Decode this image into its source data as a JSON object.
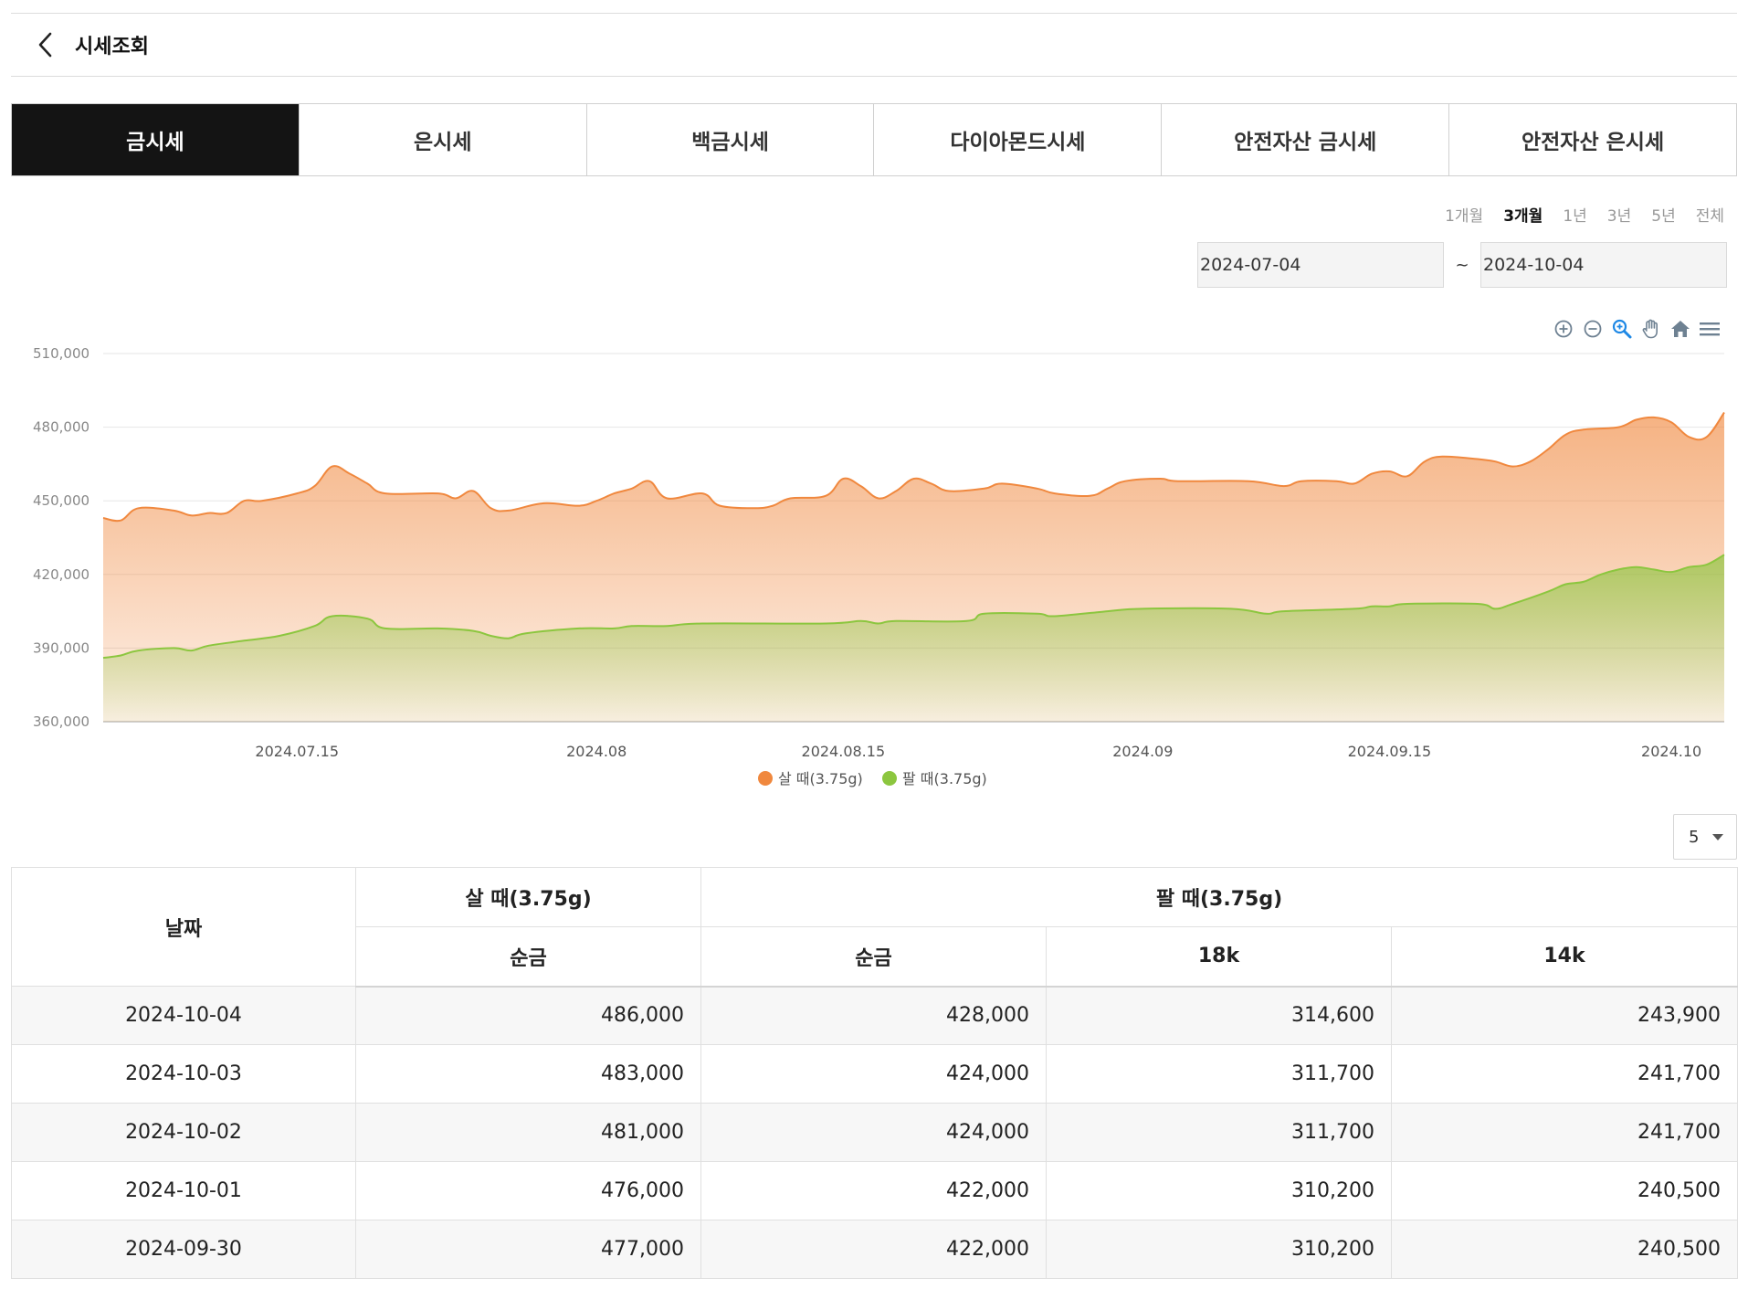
{
  "header": {
    "title": "시세조회",
    "back_icon": "chevron-left-icon"
  },
  "tabs": [
    {
      "label": "금시세",
      "active": true
    },
    {
      "label": "은시세",
      "active": false
    },
    {
      "label": "백금시세",
      "active": false
    },
    {
      "label": "다이아몬드시세",
      "active": false
    },
    {
      "label": "안전자산 금시세",
      "active": false
    },
    {
      "label": "안전자산 은시세",
      "active": false
    }
  ],
  "periods": [
    {
      "label": "1개월",
      "active": false
    },
    {
      "label": "3개월",
      "active": true
    },
    {
      "label": "1년",
      "active": false
    },
    {
      "label": "3년",
      "active": false
    },
    {
      "label": "5년",
      "active": false
    },
    {
      "label": "전체",
      "active": false
    }
  ],
  "date_range": {
    "start": "2024-07-04",
    "separator": "~",
    "end": "2024-10-04"
  },
  "toolbar_icons": [
    "zoom-in-icon",
    "zoom-out-icon",
    "selection-zoom-icon",
    "pan-hand-icon",
    "reset-home-icon",
    "menu-icon"
  ],
  "colors": {
    "buy": "#f0883e",
    "sell": "#8cc63f",
    "active_tab": "#141414"
  },
  "chart_data": {
    "type": "area",
    "ylim": [
      360000,
      510000
    ],
    "y_ticks": [
      360000,
      390000,
      420000,
      450000,
      480000,
      510000
    ],
    "y_tick_labels": [
      "360,000",
      "390,000",
      "420,000",
      "450,000",
      "480,000",
      "510,000"
    ],
    "x_range": [
      "2024-07-04",
      "2024-10-04"
    ],
    "x_ticks": [
      {
        "date": "2024-07-15",
        "label": "2024.07.15"
      },
      {
        "date": "2024-08-01",
        "label": "2024.08"
      },
      {
        "date": "2024-08-15",
        "label": "2024.08.15"
      },
      {
        "date": "2024-09-01",
        "label": "2024.09"
      },
      {
        "date": "2024-09-15",
        "label": "2024.09.15"
      },
      {
        "date": "2024-10-01",
        "label": "2024.10"
      }
    ],
    "legend_position": "bottom-center",
    "grid": true,
    "series": [
      {
        "name": "살 때(3.75g)",
        "color": "#f0883e",
        "points": [
          [
            "2024-07-04",
            443000
          ],
          [
            "2024-07-05",
            442000
          ],
          [
            "2024-07-06",
            447000
          ],
          [
            "2024-07-08",
            446000
          ],
          [
            "2024-07-09",
            444000
          ],
          [
            "2024-07-10",
            445000
          ],
          [
            "2024-07-11",
            445000
          ],
          [
            "2024-07-12",
            450000
          ],
          [
            "2024-07-13",
            450000
          ],
          [
            "2024-07-15",
            453000
          ],
          [
            "2024-07-16",
            456000
          ],
          [
            "2024-07-17",
            464000
          ],
          [
            "2024-07-18",
            461000
          ],
          [
            "2024-07-19",
            457000
          ],
          [
            "2024-07-20",
            453000
          ],
          [
            "2024-07-23",
            453000
          ],
          [
            "2024-07-24",
            451000
          ],
          [
            "2024-07-25",
            454000
          ],
          [
            "2024-07-26",
            447000
          ],
          [
            "2024-07-27",
            446000
          ],
          [
            "2024-07-29",
            449000
          ],
          [
            "2024-07-31",
            448000
          ],
          [
            "2024-08-01",
            450000
          ],
          [
            "2024-08-02",
            453000
          ],
          [
            "2024-08-03",
            455000
          ],
          [
            "2024-08-04",
            458000
          ],
          [
            "2024-08-05",
            451000
          ],
          [
            "2024-08-07",
            453000
          ],
          [
            "2024-08-08",
            448000
          ],
          [
            "2024-08-10",
            447000
          ],
          [
            "2024-08-11",
            448000
          ],
          [
            "2024-08-12",
            451000
          ],
          [
            "2024-08-14",
            452000
          ],
          [
            "2024-08-15",
            459000
          ],
          [
            "2024-08-16",
            456000
          ],
          [
            "2024-08-17",
            451000
          ],
          [
            "2024-08-18",
            454000
          ],
          [
            "2024-08-19",
            459000
          ],
          [
            "2024-08-20",
            457000
          ],
          [
            "2024-08-21",
            454000
          ],
          [
            "2024-08-23",
            455000
          ],
          [
            "2024-08-24",
            457000
          ],
          [
            "2024-08-26",
            455000
          ],
          [
            "2024-08-27",
            453000
          ],
          [
            "2024-08-29",
            452000
          ],
          [
            "2024-08-30",
            455000
          ],
          [
            "2024-08-31",
            458000
          ],
          [
            "2024-09-02",
            459000
          ],
          [
            "2024-09-03",
            458000
          ],
          [
            "2024-09-07",
            458000
          ],
          [
            "2024-09-09",
            456000
          ],
          [
            "2024-09-10",
            458000
          ],
          [
            "2024-09-12",
            458000
          ],
          [
            "2024-09-13",
            457000
          ],
          [
            "2024-09-14",
            461000
          ],
          [
            "2024-09-15",
            462000
          ],
          [
            "2024-09-16",
            460000
          ],
          [
            "2024-09-17",
            466000
          ],
          [
            "2024-09-18",
            468000
          ],
          [
            "2024-09-20",
            467000
          ],
          [
            "2024-09-21",
            466000
          ],
          [
            "2024-09-22",
            464000
          ],
          [
            "2024-09-23",
            466000
          ],
          [
            "2024-09-24",
            471000
          ],
          [
            "2024-09-25",
            477000
          ],
          [
            "2024-09-26",
            479000
          ],
          [
            "2024-09-28",
            480000
          ],
          [
            "2024-09-29",
            483000
          ],
          [
            "2024-09-30",
            484000
          ],
          [
            "2024-10-01",
            482000
          ],
          [
            "2024-10-02",
            476000
          ],
          [
            "2024-10-03",
            476000
          ],
          [
            "2024-10-04",
            486000
          ]
        ]
      },
      {
        "name": "팔 때(3.75g)",
        "color": "#8cc63f",
        "points": [
          [
            "2024-07-04",
            386000
          ],
          [
            "2024-07-05",
            387000
          ],
          [
            "2024-07-06",
            389000
          ],
          [
            "2024-07-08",
            390000
          ],
          [
            "2024-07-09",
            389000
          ],
          [
            "2024-07-10",
            391000
          ],
          [
            "2024-07-12",
            393000
          ],
          [
            "2024-07-14",
            395000
          ],
          [
            "2024-07-16",
            399000
          ],
          [
            "2024-07-17",
            403000
          ],
          [
            "2024-07-19",
            402000
          ],
          [
            "2024-07-20",
            398000
          ],
          [
            "2024-07-23",
            398000
          ],
          [
            "2024-07-25",
            397000
          ],
          [
            "2024-07-26",
            395000
          ],
          [
            "2024-07-27",
            394000
          ],
          [
            "2024-07-28",
            396000
          ],
          [
            "2024-07-31",
            398000
          ],
          [
            "2024-08-02",
            398000
          ],
          [
            "2024-08-03",
            399000
          ],
          [
            "2024-08-05",
            399000
          ],
          [
            "2024-08-07",
            400000
          ],
          [
            "2024-08-14",
            400000
          ],
          [
            "2024-08-16",
            401000
          ],
          [
            "2024-08-17",
            400000
          ],
          [
            "2024-08-18",
            401000
          ],
          [
            "2024-08-22",
            401000
          ],
          [
            "2024-08-23",
            404000
          ],
          [
            "2024-08-26",
            404000
          ],
          [
            "2024-08-27",
            403000
          ],
          [
            "2024-08-30",
            405000
          ],
          [
            "2024-09-01",
            406000
          ],
          [
            "2024-09-06",
            406000
          ],
          [
            "2024-09-08",
            404000
          ],
          [
            "2024-09-09",
            405000
          ],
          [
            "2024-09-13",
            406000
          ],
          [
            "2024-09-14",
            407000
          ],
          [
            "2024-09-15",
            407000
          ],
          [
            "2024-09-16",
            408000
          ],
          [
            "2024-09-20",
            408000
          ],
          [
            "2024-09-21",
            406000
          ],
          [
            "2024-09-22",
            408000
          ],
          [
            "2024-09-24",
            413000
          ],
          [
            "2024-09-25",
            416000
          ],
          [
            "2024-09-26",
            417000
          ],
          [
            "2024-09-27",
            420000
          ],
          [
            "2024-09-28",
            422000
          ],
          [
            "2024-09-29",
            423000
          ],
          [
            "2024-09-30",
            422000
          ],
          [
            "2024-10-01",
            421000
          ],
          [
            "2024-10-02",
            423000
          ],
          [
            "2024-10-03",
            424000
          ],
          [
            "2024-10-04",
            428000
          ]
        ]
      }
    ]
  },
  "rows_select": {
    "value": "5"
  },
  "table": {
    "date_header": "날짜",
    "buy_group": "살 때(3.75g)",
    "sell_group": "팔 때(3.75g)",
    "sub_headers": [
      "순금",
      "순금",
      "18k",
      "14k"
    ],
    "rows": [
      [
        "2024-10-04",
        "486,000",
        "428,000",
        "314,600",
        "243,900"
      ],
      [
        "2024-10-03",
        "483,000",
        "424,000",
        "311,700",
        "241,700"
      ],
      [
        "2024-10-02",
        "481,000",
        "424,000",
        "311,700",
        "241,700"
      ],
      [
        "2024-10-01",
        "476,000",
        "422,000",
        "310,200",
        "240,500"
      ],
      [
        "2024-09-30",
        "477,000",
        "422,000",
        "310,200",
        "240,500"
      ]
    ]
  }
}
